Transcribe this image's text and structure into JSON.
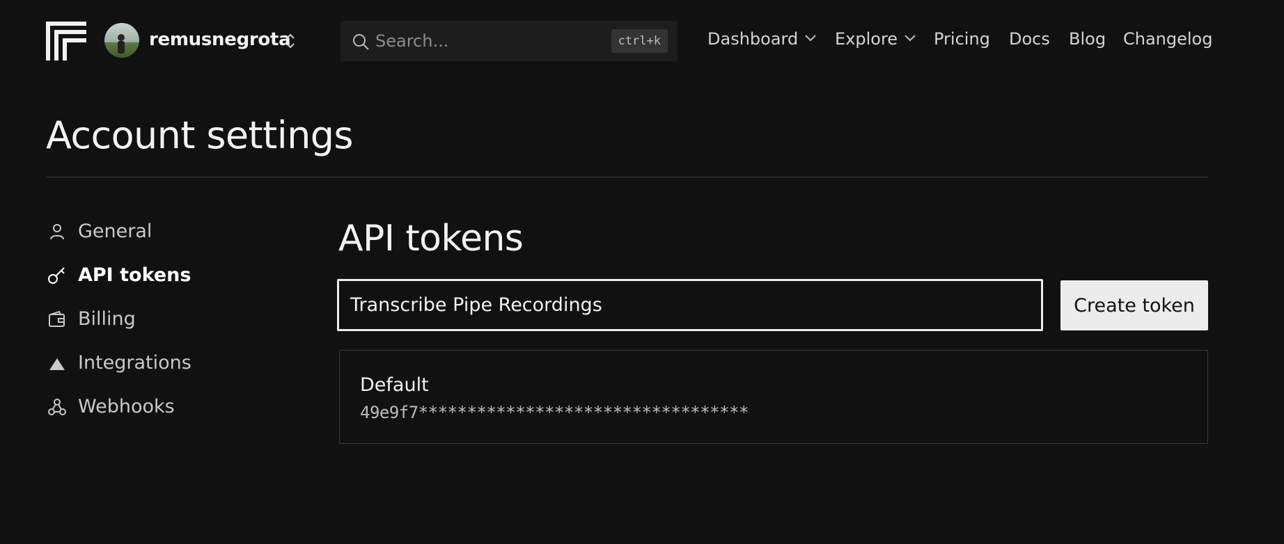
{
  "header": {
    "username": "remusnegrota",
    "search": {
      "placeholder": "Search...",
      "shortcut": "ctrl+k"
    },
    "nav": {
      "dashboard": "Dashboard",
      "explore": "Explore",
      "pricing": "Pricing",
      "docs": "Docs",
      "blog": "Blog",
      "changelog": "Changelog"
    }
  },
  "page": {
    "title": "Account settings"
  },
  "sidebar": {
    "items": [
      {
        "label": "General",
        "icon": "user-icon"
      },
      {
        "label": "API tokens",
        "icon": "key-icon",
        "active": true
      },
      {
        "label": "Billing",
        "icon": "wallet-icon"
      },
      {
        "label": "Integrations",
        "icon": "triangle-icon"
      },
      {
        "label": "Webhooks",
        "icon": "webhook-icon"
      }
    ]
  },
  "main": {
    "section_title": "API tokens",
    "token_input_value": "Transcribe Pipe Recordings",
    "create_button_label": "Create token",
    "tokens": [
      {
        "name": "Default",
        "value": "49e9f7**********************************"
      }
    ]
  },
  "colors": {
    "background": "#111111",
    "text": "#f2f2f2",
    "muted": "#c9c9c9",
    "button_bg": "#ececec"
  }
}
